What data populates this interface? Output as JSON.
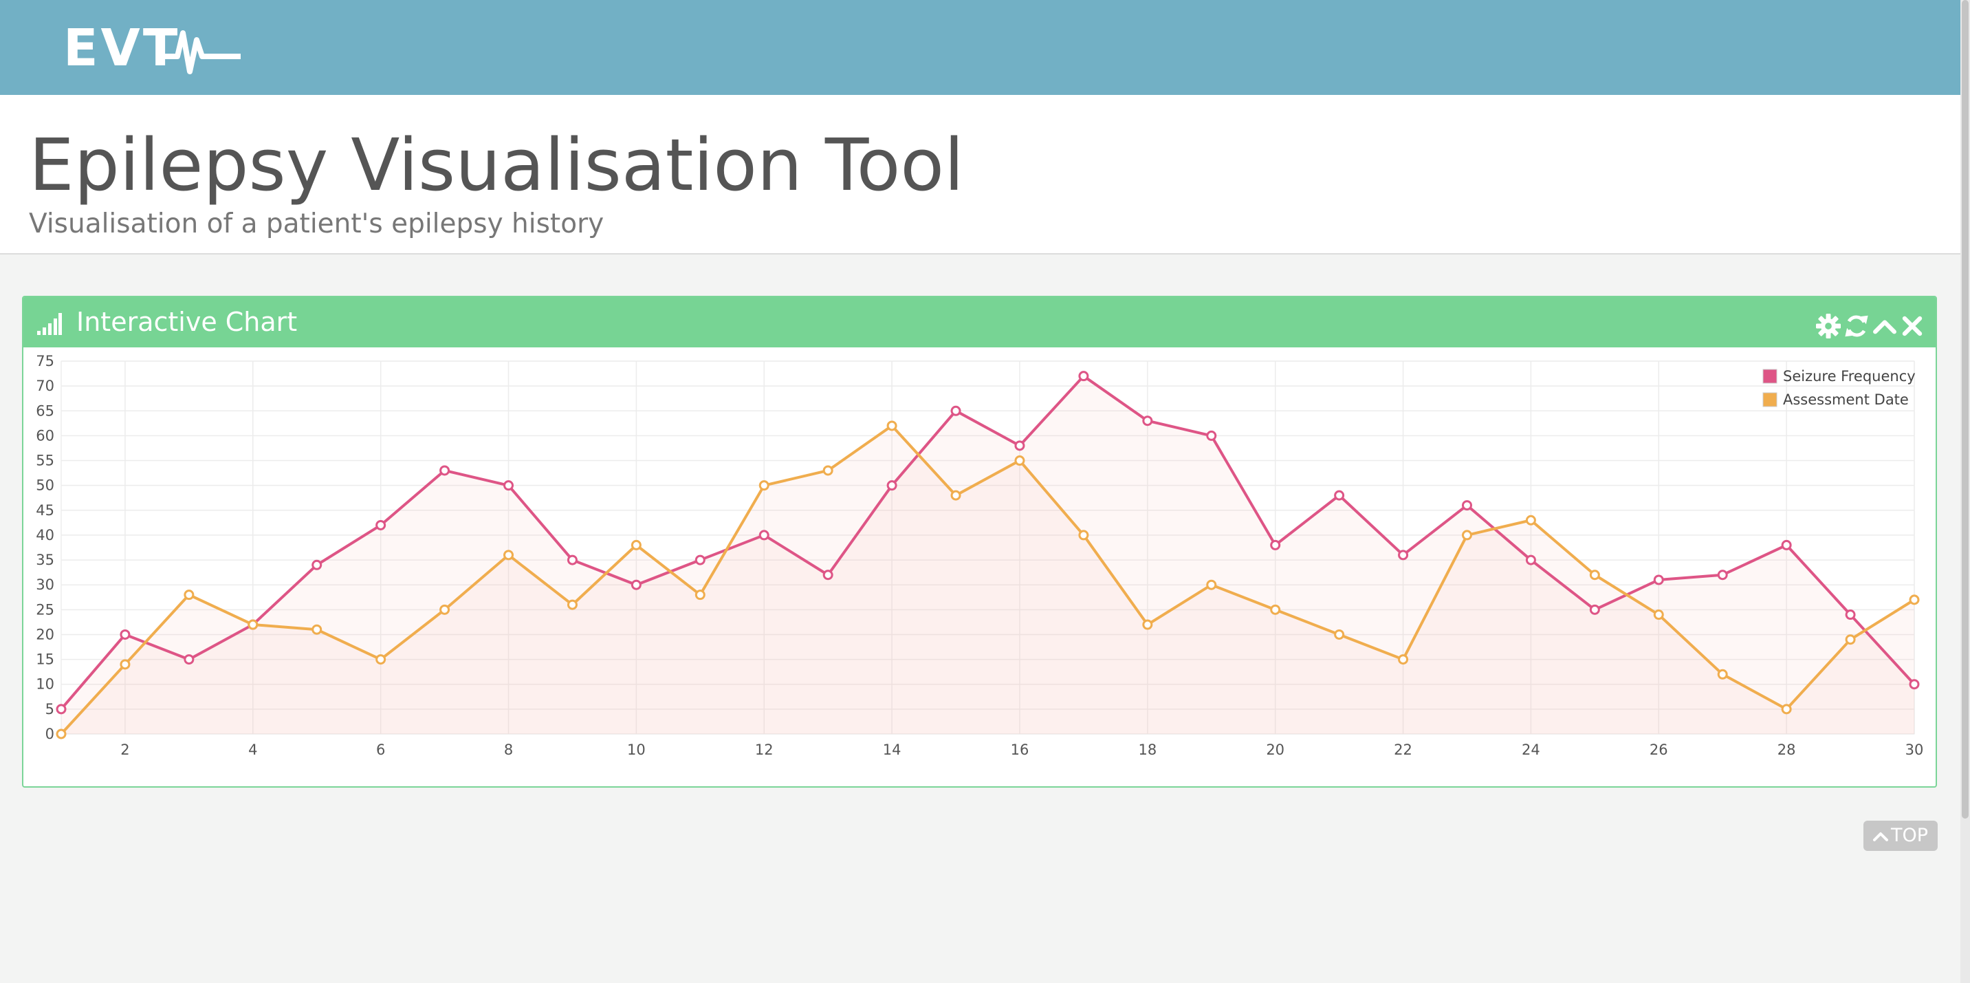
{
  "brand": {
    "logo_text": "EVT"
  },
  "header": {
    "title": "Epilepsy Visualisation Tool",
    "subtitle": "Visualisation of a patient's epilepsy history"
  },
  "panel": {
    "title": "Interactive Chart",
    "icons": [
      "bar-chart-icon",
      "gear-icon",
      "refresh-icon",
      "chevron-up-icon",
      "close-icon"
    ]
  },
  "top_button": {
    "label": "TOP",
    "icon": "chevron-up-icon"
  },
  "colors": {
    "topbar": "#72b0c5",
    "panel_header": "#77d494",
    "series_seizure": "#de5586",
    "series_assessment": "#f0ad4e"
  },
  "chart_data": {
    "type": "line",
    "x": [
      1,
      2,
      3,
      4,
      5,
      6,
      7,
      8,
      9,
      10,
      11,
      12,
      13,
      14,
      15,
      16,
      17,
      18,
      19,
      20,
      21,
      22,
      23,
      24,
      25,
      26,
      27,
      28,
      29,
      30
    ],
    "x_ticks": [
      2,
      4,
      6,
      8,
      10,
      12,
      14,
      16,
      18,
      20,
      22,
      24,
      26,
      28,
      30
    ],
    "y_ticks": [
      0,
      5,
      10,
      15,
      20,
      25,
      30,
      35,
      40,
      45,
      50,
      55,
      60,
      65,
      70,
      75
    ],
    "xlim": [
      1,
      30
    ],
    "ylim": [
      0,
      75
    ],
    "grid": true,
    "legend_position": "top-right",
    "series": [
      {
        "name": "Seizure Frequency",
        "color": "#de5586",
        "values": [
          5,
          20,
          15,
          22,
          34,
          42,
          53,
          50,
          35,
          30,
          35,
          40,
          32,
          50,
          65,
          58,
          72,
          63,
          60,
          38,
          48,
          36,
          46,
          35,
          25,
          31,
          32,
          38,
          24,
          10
        ]
      },
      {
        "name": "Assessment Date",
        "color": "#f0ad4e",
        "values": [
          0,
          14,
          28,
          22,
          21,
          15,
          25,
          36,
          26,
          38,
          28,
          50,
          53,
          62,
          48,
          55,
          40,
          22,
          30,
          25,
          20,
          15,
          40,
          43,
          32,
          24,
          12,
          5,
          19,
          27
        ]
      }
    ]
  }
}
